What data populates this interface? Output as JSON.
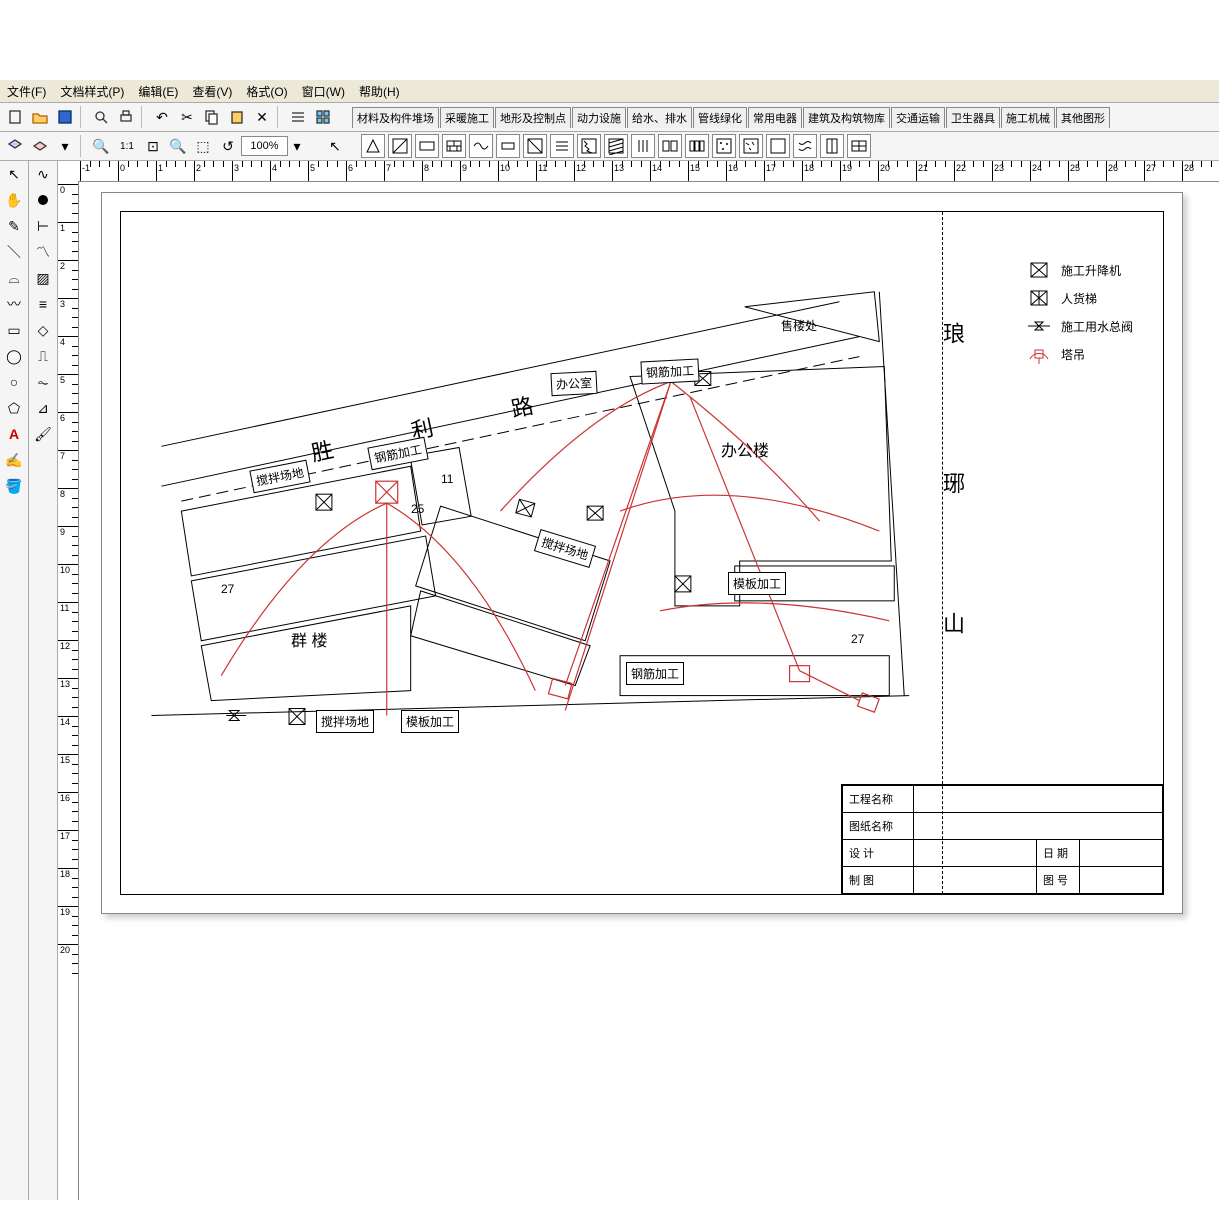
{
  "menubar": {
    "file": "文件(F)",
    "docstyle": "文档样式(P)",
    "edit": "编辑(E)",
    "view": "查看(V)",
    "format": "格式(O)",
    "window": "窗口(W)",
    "help": "帮助(H)"
  },
  "toolbar": {
    "zoom_ratio": "1:1",
    "zoom_value": "100%"
  },
  "tabs": [
    "材料及构件堆场",
    "采暖施工",
    "地形及控制点",
    "动力设施",
    "给水、排水",
    "管线绿化",
    "常用电器",
    "建筑及构筑物库",
    "交通运输",
    "卫生器具",
    "施工机械",
    "其他图形"
  ],
  "ruler": {
    "h_labels": [
      "-1",
      "0",
      "1",
      "2",
      "3",
      "4",
      "5",
      "6",
      "7",
      "8",
      "9",
      "10",
      "11",
      "12",
      "13",
      "14",
      "15",
      "16",
      "17",
      "18",
      "19",
      "20",
      "21",
      "22",
      "23",
      "24",
      "25",
      "26",
      "27",
      "28"
    ],
    "v_labels": [
      "0",
      "1",
      "2",
      "3",
      "4",
      "5",
      "6",
      "7",
      "8",
      "9",
      "10",
      "11",
      "12",
      "13",
      "14",
      "15",
      "16",
      "17",
      "18",
      "19",
      "20"
    ]
  },
  "drawing": {
    "road": {
      "c1": "胜",
      "c2": "利",
      "c3": "路"
    },
    "east": {
      "c1": "琅",
      "c2": "琊",
      "c3": "山"
    },
    "boxes": {
      "mix1": "搅拌场地",
      "rebar1": "钢筋加工",
      "office": "办公室",
      "rebar2": "钢筋加工",
      "mix2": "搅拌场地",
      "rebar3": "钢筋加工",
      "form1": "模板加工",
      "mix3": "搅拌场地",
      "form2": "模板加工"
    },
    "labels": {
      "sales": "售楼处",
      "officeBldg": "办公楼",
      "qunlou": "群  楼",
      "n11": "11",
      "n25": "25",
      "n27a": "27",
      "n27b": "27"
    },
    "legend": {
      "lift": "施工升降机",
      "elevator": "人货梯",
      "valve": "施工用水总阀",
      "crane": "塔吊"
    },
    "titleblock": {
      "project": "工程名称",
      "drawing": "图纸名称",
      "design": "设   计",
      "date": "日  期",
      "draft": "制   图",
      "sheet": "图  号"
    }
  }
}
